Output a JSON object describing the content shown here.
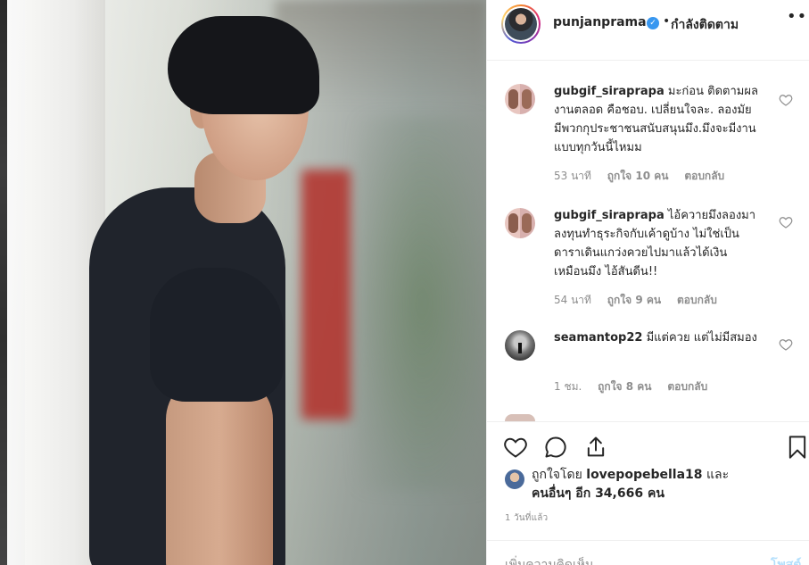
{
  "post": {
    "author": "punjanprama",
    "verified_icon": "verified-badge-icon",
    "separator": "•",
    "follow_status": "กำลังติดตาม",
    "more_icon": "more-options-icon"
  },
  "comments": [
    {
      "username": "gubgif_siraprapa",
      "text": "มะก่อน ติดตามผลงานตลอด คือชอบ. เปลี่ยนใจละ. ลองมัยมีพวกกุประชาชนสนับสนุนมึง.มึงจะมีงานแบบทุกวันนี้ไหมม",
      "time": "53 นาที",
      "likes": "ถูกใจ 10 คน",
      "reply": "ตอบกลับ"
    },
    {
      "username": "gubgif_siraprapa",
      "text": "ไอ้ควายมึงลองมาลงทุนทำธุระกิจกับเค้าดูบ้าง ไม่ใช่เป็นดาราเดินแกว่งควยไปมาแล้วได้เงินเหมือนมึง ไอ้สันดีน!!",
      "time": "54 นาที",
      "likes": "ถูกใจ 9 คน",
      "reply": "ตอบกลับ"
    },
    {
      "username": "seamantop22",
      "text": "มีแต่ควย แต่ไม่มีสมอง",
      "time": "1 ชม.",
      "likes": "ถูกใจ 8 คน",
      "reply": "ตอบกลับ"
    }
  ],
  "actions": {
    "like_icon": "heart-icon",
    "comment_icon": "comment-icon",
    "share_icon": "share-icon",
    "save_icon": "bookmark-icon"
  },
  "liked_by": {
    "prefix": "ถูกใจโดย",
    "user": "lovepopebella18",
    "conj": "และ",
    "others": "คนอื่นๆ อีก 34,666 คน"
  },
  "timestamp": "1 วันที่แล้ว",
  "add_comment": {
    "placeholder": "เพิ่มความคิดเห็น...",
    "post_label": "โพสต์"
  }
}
